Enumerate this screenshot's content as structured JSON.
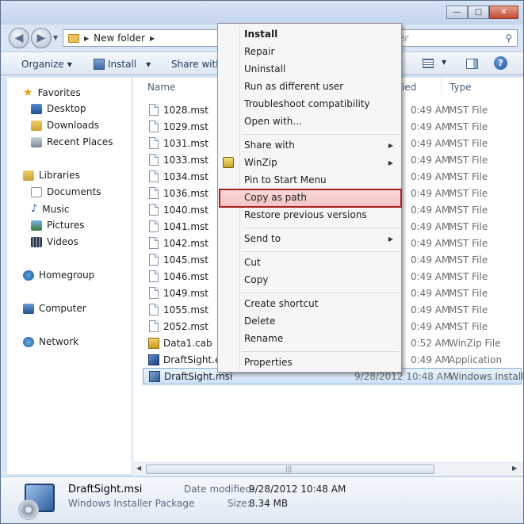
{
  "window": {
    "caption_min": "—",
    "caption_max": "□",
    "caption_close": "✕"
  },
  "navbar": {
    "back_arrow": "◀",
    "forward_arrow": "▶",
    "breadcrumb_folder": "New folder",
    "search_placeholder_fragment": "er"
  },
  "toolbar": {
    "organize": "Organize",
    "install": "Install",
    "share_with": "Share with"
  },
  "navpane": {
    "items": [
      {
        "label": "Favorites",
        "icon": "star-icon"
      },
      {
        "label": "Desktop",
        "icon": "desktop-icon"
      },
      {
        "label": "Downloads",
        "icon": "downloads-icon"
      },
      {
        "label": "Recent Places",
        "icon": "recent-places-icon"
      },
      {
        "label": "Libraries",
        "icon": "libraries-icon"
      },
      {
        "label": "Documents",
        "icon": "documents-icon"
      },
      {
        "label": "Music",
        "icon": "music-icon"
      },
      {
        "label": "Pictures",
        "icon": "pictures-icon"
      },
      {
        "label": "Videos",
        "icon": "videos-icon"
      },
      {
        "label": "Homegroup",
        "icon": "homegroup-icon"
      },
      {
        "label": "Computer",
        "icon": "computer-icon"
      },
      {
        "label": "Network",
        "icon": "network-icon"
      }
    ]
  },
  "filelist": {
    "headers": {
      "name": "Name",
      "date": "ied",
      "type": "Type"
    },
    "rows": [
      {
        "name": "1028.mst",
        "date": "0:49 AM",
        "type": "MST File"
      },
      {
        "name": "1029.mst",
        "date": "0:49 AM",
        "type": "MST File"
      },
      {
        "name": "1031.mst",
        "date": "0:49 AM",
        "type": "MST File"
      },
      {
        "name": "1033.mst",
        "date": "0:49 AM",
        "type": "MST File"
      },
      {
        "name": "1034.mst",
        "date": "0:49 AM",
        "type": "MST File"
      },
      {
        "name": "1036.mst",
        "date": "0:49 AM",
        "type": "MST File"
      },
      {
        "name": "1040.mst",
        "date": "0:49 AM",
        "type": "MST File"
      },
      {
        "name": "1041.mst",
        "date": "0:49 AM",
        "type": "MST File"
      },
      {
        "name": "1042.mst",
        "date": "0:49 AM",
        "type": "MST File"
      },
      {
        "name": "1045.mst",
        "date": "0:49 AM",
        "type": "MST File"
      },
      {
        "name": "1046.mst",
        "date": "0:49 AM",
        "type": "MST File"
      },
      {
        "name": "1049.mst",
        "date": "0:49 AM",
        "type": "MST File"
      },
      {
        "name": "1055.mst",
        "date": "0:49 AM",
        "type": "MST File"
      },
      {
        "name": "2052.mst",
        "date": "0:49 AM",
        "type": "MST File"
      },
      {
        "name": "Data1.cab",
        "date": "0:52 AM",
        "type": "WinZip File"
      },
      {
        "name": "DraftSight.ex",
        "date": "0:49 AM",
        "type": "Application"
      },
      {
        "name": "DraftSight.msi",
        "date": "9/28/2012 10:48 AM",
        "type": "Windows Installe"
      }
    ]
  },
  "context_menu": {
    "install": "Install",
    "repair": "Repair",
    "uninstall": "Uninstall",
    "run_as": "Run as different user",
    "troubleshoot": "Troubleshoot compatibility",
    "open_with": "Open with...",
    "share_with": "Share with",
    "winzip": "WinZip",
    "pin_start": "Pin to Start Menu",
    "copy_as_path": "Copy as path",
    "restore": "Restore previous versions",
    "send_to": "Send to",
    "cut": "Cut",
    "copy": "Copy",
    "create_shortcut": "Create shortcut",
    "delete": "Delete",
    "rename": "Rename",
    "properties": "Properties"
  },
  "details": {
    "name": "DraftSight.msi",
    "type": "Windows Installer Package",
    "modified_label": "Date modified:",
    "modified_value": "9/28/2012 10:48 AM",
    "size_label": "Size:",
    "size_value": "8.34 MB"
  },
  "colors": {
    "highlight_border": "#a81f24",
    "highlight_fill": "#f6cfcf",
    "selection": "#cfe2f9"
  }
}
